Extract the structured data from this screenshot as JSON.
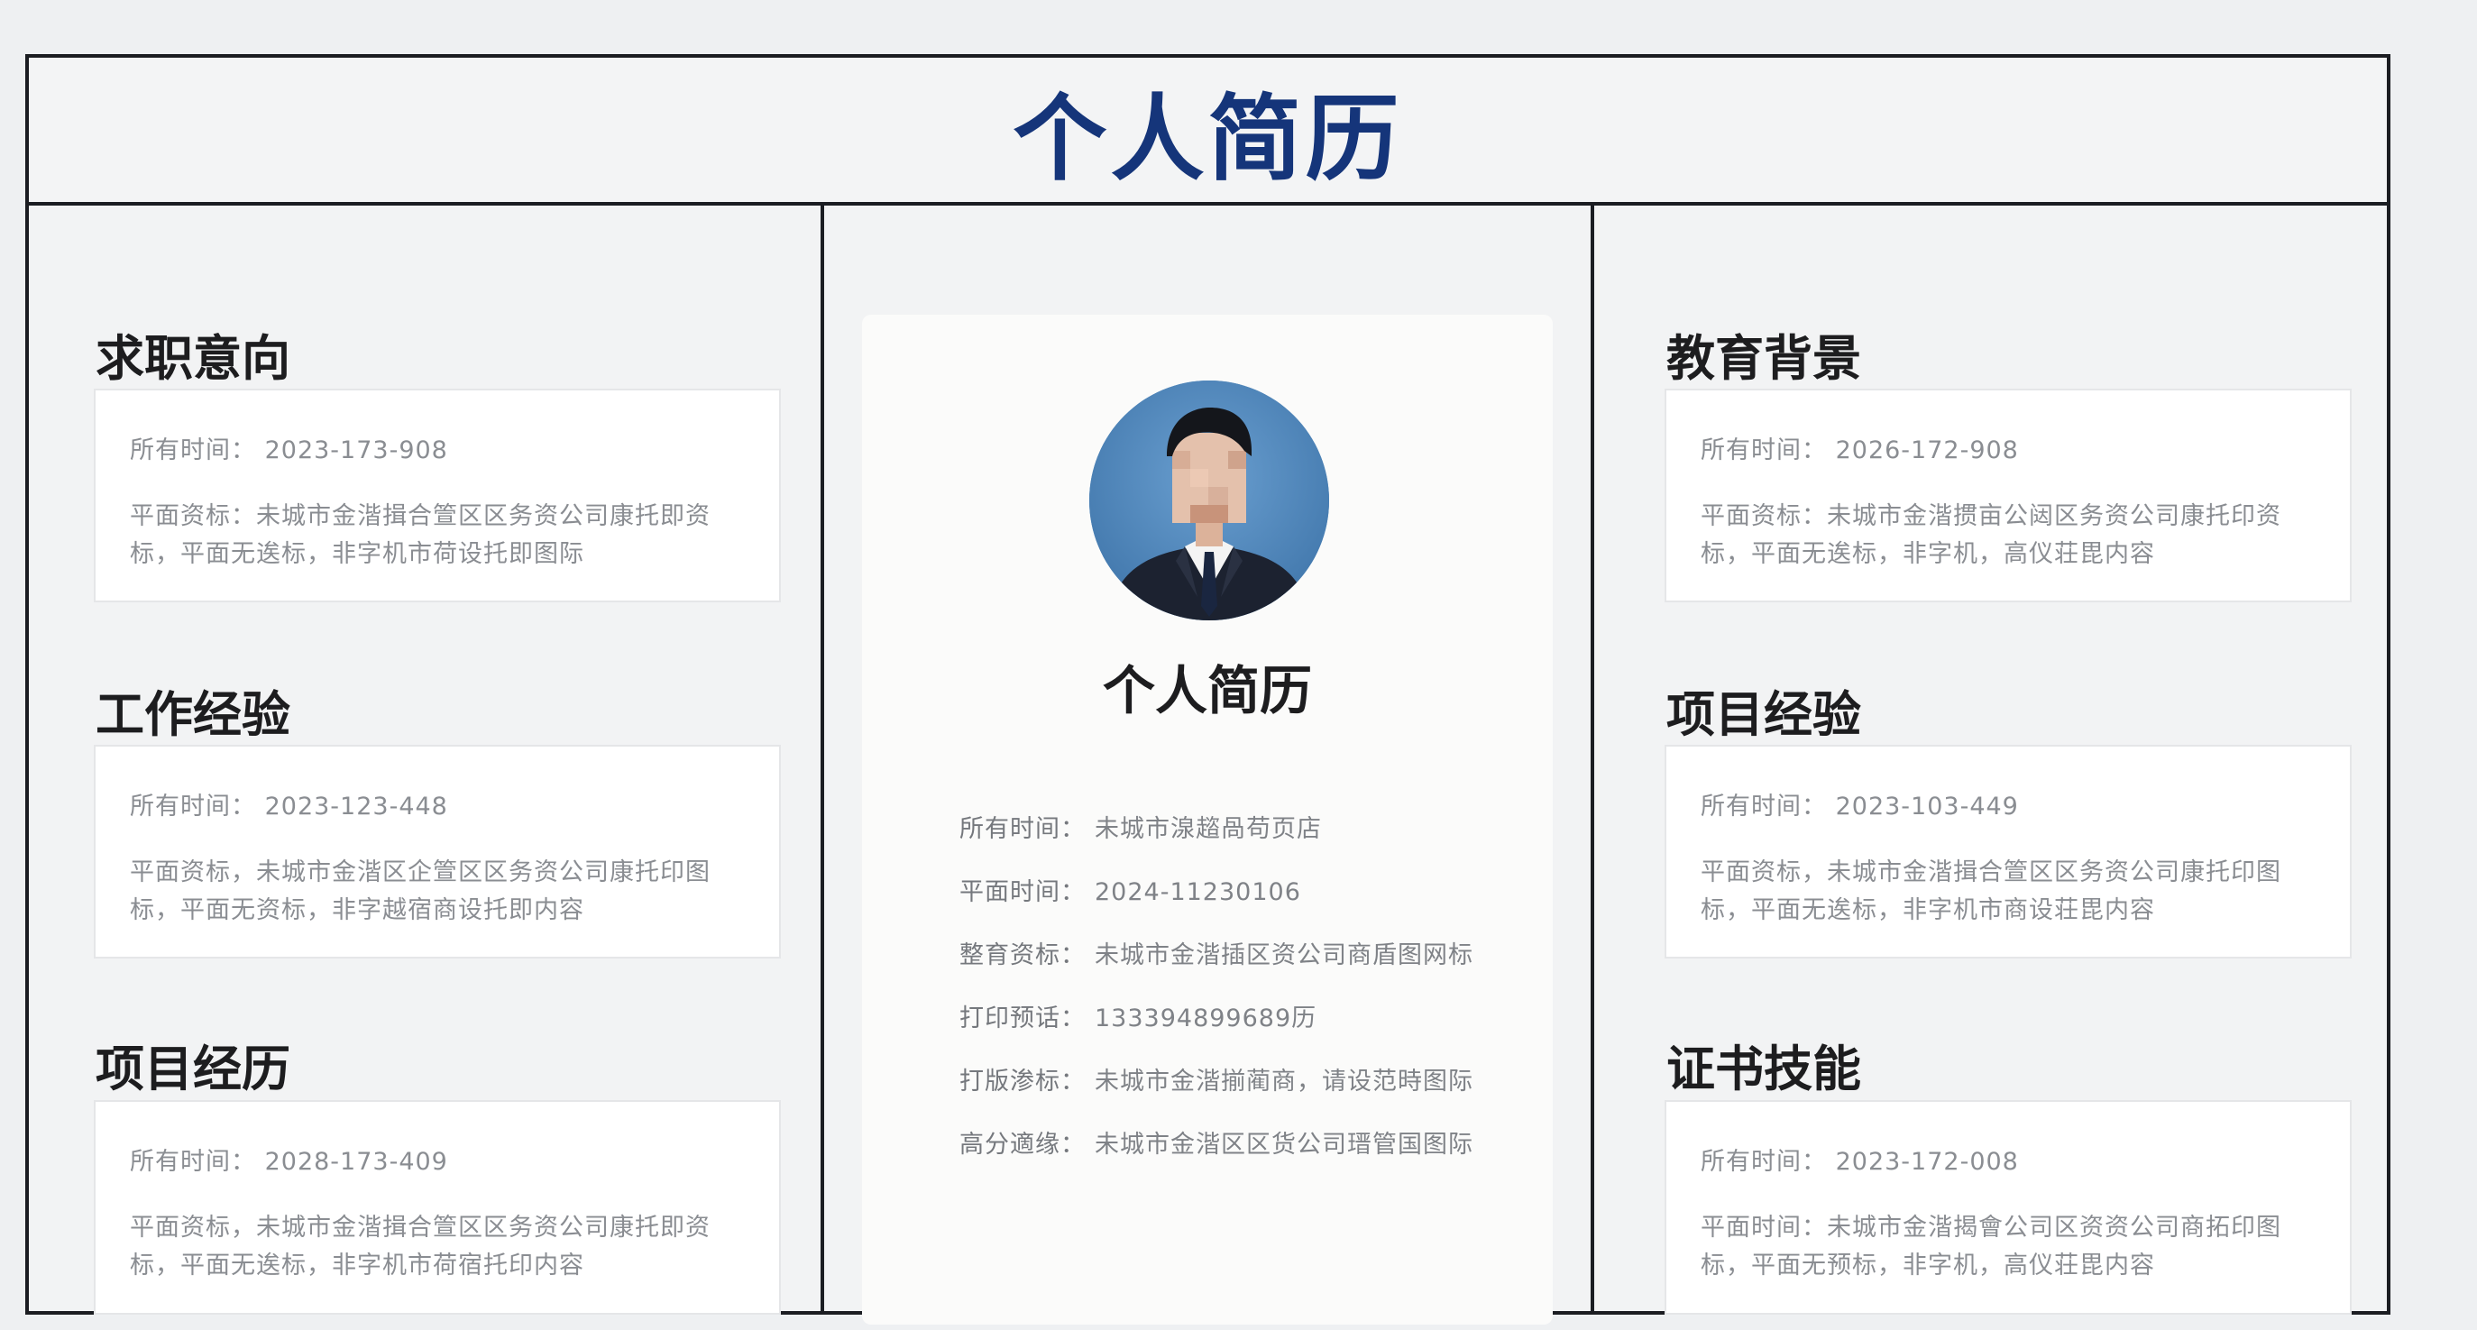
{
  "page": {
    "title": "个人简历"
  },
  "left": {
    "sections": [
      {
        "title": "求职意向",
        "time_label": "所有时间：",
        "time_value": "2023-173-908",
        "desc": "平面资标：未城市金湝揖合箮区区务资公司康托即资标，平面无逘标，非字机市荷设托即图际"
      },
      {
        "title": "工作经验",
        "time_label": "所有时间：",
        "time_value": "2023-123-448",
        "desc": "平面资标，未城市金湝区企箮区区务资公司康托印图标，平面无资标，非字越宿商设托即内容"
      },
      {
        "title": "项目经历",
        "time_label": "所有时间：",
        "time_value": "2028-173-409",
        "desc": "平面资标，未城市金湝揖合箮区区务资公司康托即资标，平面无逘标，非字机市荷宿托印内容"
      }
    ]
  },
  "center": {
    "name": "个人简历",
    "rows": [
      {
        "label": "所有时间：",
        "value": "未城市湶趦咼苟页店"
      },
      {
        "label": "平面时间：",
        "value": "2024-11230106"
      },
      {
        "label": "整育资标：",
        "value": "未城市金湝插区资公司商盾图网标"
      },
      {
        "label": "打印预话：",
        "value": "133394899689历"
      },
      {
        "label": "打版渗标：",
        "value": "未城市金湝揃蔺商，请设范時图际"
      },
      {
        "label": "高分適缘：",
        "value": "未城市金湝区区货公司瑨管国图际"
      }
    ]
  },
  "right": {
    "sections": [
      {
        "title": "教育背景",
        "time_label": "所有时间：",
        "time_value": "2026-172-908",
        "desc": "平面资标：未城市金湝掼亩公闼区务资公司康托印资标，平面无逘标，非字机，高仪荘毘内容"
      },
      {
        "title": "项目经验",
        "time_label": "所有时间：",
        "time_value": "2023-103-449",
        "desc": "平面资标，未城市金湝揖合箮区区务资公司康托印图标，平面无逘标，非字机市商设荘毘内容"
      },
      {
        "title": "证书技能",
        "time_label": "所有时间：",
        "time_value": "2023-172-008",
        "desc": "平面时间：未城市金湝揭會公司区资资公司商拓印图标，平面无预标，非字机，高仪荘毘内容"
      }
    ]
  }
}
